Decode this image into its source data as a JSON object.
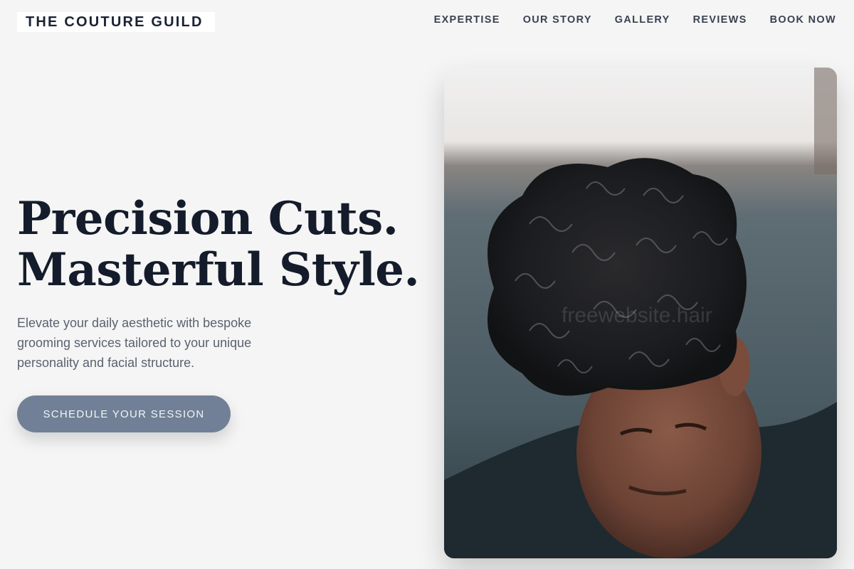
{
  "brand": {
    "logo_text": "THE COUTURE GUILD"
  },
  "nav": {
    "items": [
      {
        "label": "EXPERTISE"
      },
      {
        "label": "OUR STORY"
      },
      {
        "label": "GALLERY"
      },
      {
        "label": "REVIEWS"
      },
      {
        "label": "BOOK NOW"
      }
    ]
  },
  "hero": {
    "title_line1": "Precision Cuts.",
    "title_line2": "Masterful Style.",
    "subtitle": "Elevate your daily aesthetic with bespoke grooming services tailored to your unique personality and facial structure.",
    "cta_label": "SCHEDULE YOUR SESSION",
    "image_alt": "Man with dark curly hair looking down",
    "image_watermark": "freewebsite.hair"
  },
  "colors": {
    "background": "#f5f5f5",
    "heading": "#141c2b",
    "accent": "#718096"
  }
}
